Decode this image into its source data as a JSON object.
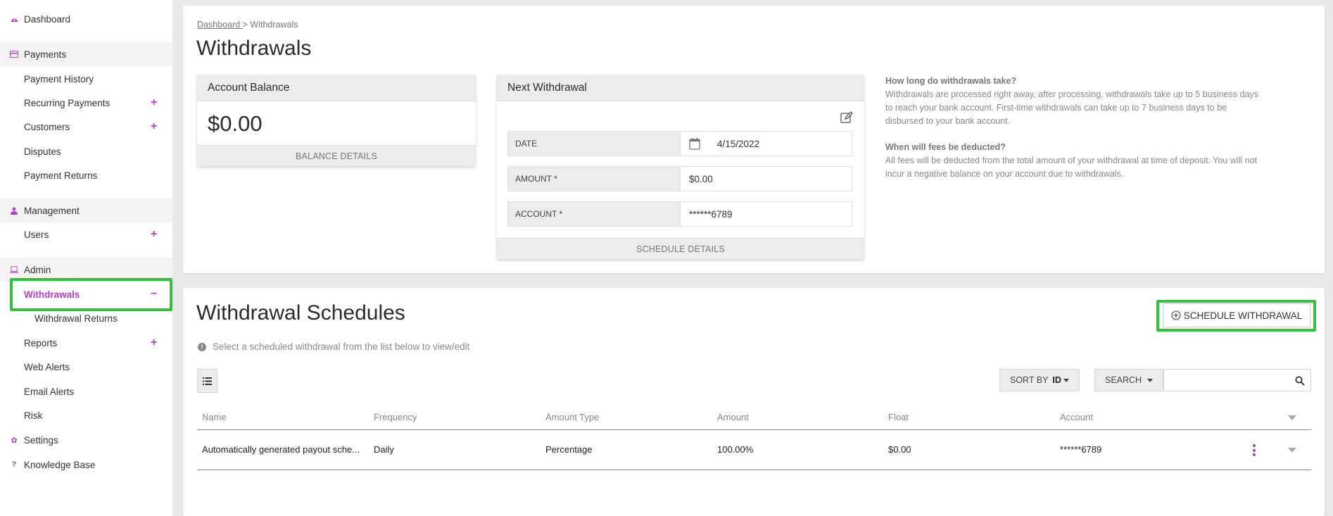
{
  "sidebar": {
    "items": [
      {
        "label": "Dashboard"
      },
      {
        "label": "Payments"
      },
      {
        "label": "Payment History"
      },
      {
        "label": "Recurring Payments",
        "expand": "+"
      },
      {
        "label": "Customers",
        "expand": "+"
      },
      {
        "label": "Disputes"
      },
      {
        "label": "Payment Returns"
      },
      {
        "label": "Management"
      },
      {
        "label": "Users",
        "expand": "+"
      },
      {
        "label": "Admin"
      },
      {
        "label": "Withdrawals",
        "expand": "−"
      },
      {
        "label": "Withdrawal Returns"
      },
      {
        "label": "Reports",
        "expand": "+"
      },
      {
        "label": "Web Alerts"
      },
      {
        "label": "Email Alerts"
      },
      {
        "label": "Risk"
      },
      {
        "label": "Settings"
      },
      {
        "label": "Knowledge Base"
      }
    ]
  },
  "breadcrumb": {
    "root": "Dashboard ",
    "sep": "> ",
    "current": "Withdrawals"
  },
  "page_title": "Withdrawals",
  "balance_card": {
    "title": "Account Balance",
    "amount": "$0.00",
    "footer": "BALANCE DETAILS"
  },
  "next_withdrawal": {
    "title": "Next Withdrawal",
    "date_label": "DATE",
    "date_value": "4/15/2022",
    "amount_label": "AMOUNT *",
    "amount_value": "$0.00",
    "account_label": "ACCOUNT *",
    "account_value": "******6789",
    "footer": "SCHEDULE DETAILS"
  },
  "help": {
    "q1": "How long do withdrawals take?",
    "a1": "Withdrawals are processed right away, after processing, withdrawals take up to 5 business days to reach your bank account. First-time withdrawals can take up to 7 business days to be disbursed to your bank account.",
    "q2": "When will fees be deducted?",
    "a2": "All fees will be deducted from the total amount of your withdrawal at time of deposit. You will not incur a negative balance on your account due to withdrawals."
  },
  "schedules": {
    "title": "Withdrawal Schedules",
    "schedule_button": "SCHEDULE WITHDRAWAL",
    "hint": "Select a scheduled withdrawal from the list below to view/edit",
    "sort_label": "SORT BY",
    "sort_value": "ID",
    "search_label": "SEARCH",
    "columns": [
      "Name",
      "Frequency",
      "Amount Type",
      "Amount",
      "Float",
      "Account"
    ],
    "rows": [
      [
        "Automatically generated payout sche...",
        "Daily",
        "Percentage",
        "100.00%",
        "$0.00",
        "******6789"
      ]
    ]
  },
  "colors": {
    "accent": "#b040c8",
    "highlight": "#35c03f"
  }
}
